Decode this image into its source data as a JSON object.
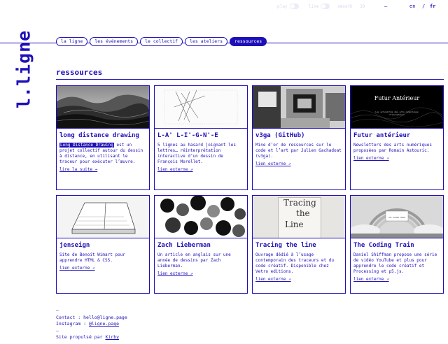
{
  "toolbar": {
    "items": [
      "play",
      "line",
      "smooth",
      "3D"
    ],
    "dash": "—",
    "lang": [
      "en",
      "/",
      "fr"
    ]
  },
  "logo": "l.ligne",
  "nav": [
    "la ligne",
    "les événements",
    "le collectif",
    "les ateliers",
    "ressources"
  ],
  "page_title": "ressources",
  "cards": [
    {
      "title": "long distance drawing",
      "desc_highlight": "Long Distance Drawing",
      "desc": " est un projet collectif autour du dessin à distance, en utilisant le traceur pour exécuter l’œuvre.",
      "link": "lire la suite →"
    },
    {
      "title": "L-A' L-I'-G-N'-E",
      "desc": "5 lignes au hasard joignant les lettres… réinterprétation interactive d’un dessin de François Morellet.",
      "link": "lien externe ↗"
    },
    {
      "title": "v3ga (GitHub)",
      "desc": "Mine d’or de ressources sur le code et l’art par Julien Gachadoat (v3ga).",
      "link": "lien externe ↗"
    },
    {
      "title": "Futur antérieur",
      "thumb_title": "Futur Antérieur",
      "thumb_sub": "Les actualités des arts numériques francophones",
      "desc": "Newsletters des arts numériques proposées par Romain Astouric.",
      "link": "lien externe ↗"
    },
    {
      "title": "jenseign",
      "desc": "Site de Benoit Wimart pour apprendre HTML & CSS.",
      "link": "lien externe ↗"
    },
    {
      "title": "Zach Lieberman",
      "desc": "Un article en anglais sur une année de dessins par Zach Lieberman.",
      "link": "lien externe ↗"
    },
    {
      "title": "Tracing the line",
      "thumb_text": [
        "Tracing",
        "the",
        "Line"
      ],
      "desc": "Ouvrage dédié à l’usage contemporain des traceurs et du code créatif. Disponible chez Vetro editions.",
      "link": "lien externe ↗"
    },
    {
      "title": "The Coding Train",
      "thumb_text": [
        "THE CODING TRAIN"
      ],
      "desc": "Daniel Shiffman propose une série de vidéo YouTube et plus pour apprendre le code créatif et Processing et p5.js.",
      "link": "lien externe ↗"
    }
  ],
  "footer": {
    "dash1": "—",
    "contact_label": "Contact : ",
    "contact_value": "hello@ligne.page",
    "instagram_label": "Instagram : ",
    "instagram_value": "@ligne.page",
    "dash2": "—",
    "powered_label": "Site propulsé par ",
    "powered_value": "Kirby"
  },
  "colors": {
    "accent": "#1e10b8",
    "background": "#ffffff"
  }
}
